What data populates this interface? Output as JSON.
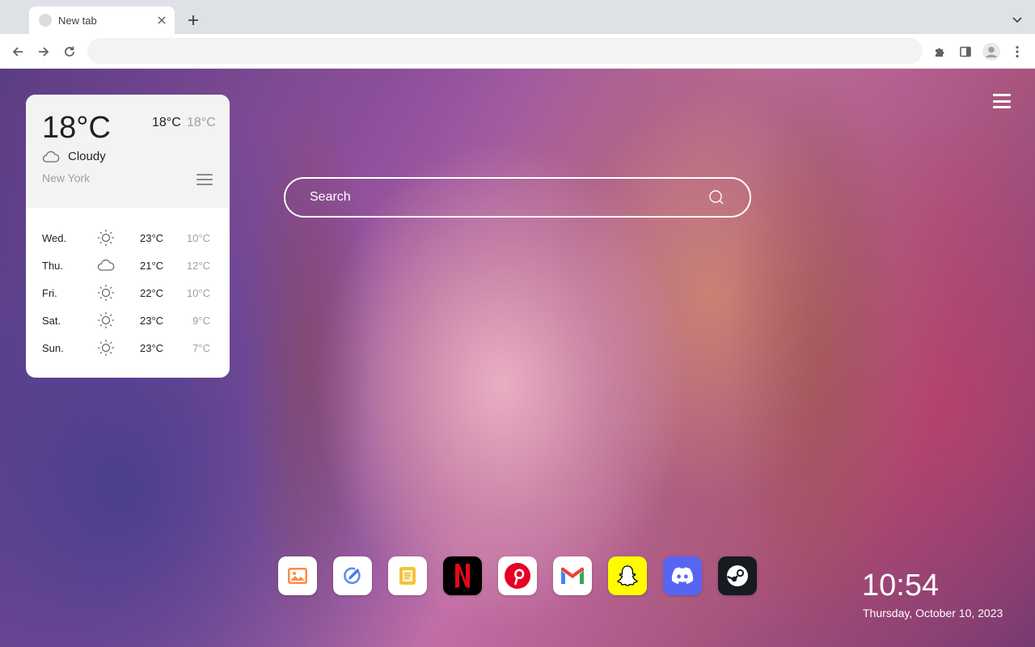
{
  "browser": {
    "tab_title": "New tab",
    "address_value": "",
    "icons": [
      "favicon",
      "close-icon",
      "plus-icon",
      "chevron-down-icon",
      "back-arrow-icon",
      "forward-arrow-icon",
      "reload-icon",
      "extensions-puzzle-icon",
      "side-panel-icon",
      "profile-avatar-icon",
      "kebab-menu-icon"
    ]
  },
  "weather": {
    "current_temp": "18°C",
    "high": "18°C",
    "low": "18°C",
    "condition": "Cloudy",
    "city": "New York",
    "forecast": [
      {
        "day": "Wed.",
        "icon": "sun-icon",
        "high": "23°C",
        "low": "10°C"
      },
      {
        "day": "Thu.",
        "icon": "cloud-icon",
        "high": "21°C",
        "low": "12°C"
      },
      {
        "day": "Fri.",
        "icon": "sun-icon",
        "high": "22°C",
        "low": "10°C"
      },
      {
        "day": "Sat.",
        "icon": "sun-icon",
        "high": "23°C",
        "low": "9°C"
      },
      {
        "day": "Sun.",
        "icon": "sun-icon",
        "high": "23°C",
        "low": "7°C"
      }
    ]
  },
  "search": {
    "placeholder": "Search"
  },
  "dock": [
    {
      "name": "photos",
      "icon": "photo-icon",
      "bg": "#ffffff"
    },
    {
      "name": "edit",
      "icon": "pen-circle-icon",
      "bg": "#ffffff"
    },
    {
      "name": "notes",
      "icon": "notes-icon",
      "bg": "#ffffff"
    },
    {
      "name": "netflix",
      "icon": "netflix-icon",
      "bg": "#000000"
    },
    {
      "name": "pinterest",
      "icon": "pinterest-icon",
      "bg": "#ffffff"
    },
    {
      "name": "gmail",
      "icon": "gmail-icon",
      "bg": "#ffffff"
    },
    {
      "name": "snapchat",
      "icon": "snapchat-icon",
      "bg": "#fffc00"
    },
    {
      "name": "discord",
      "icon": "discord-icon",
      "bg": "#5865f2"
    },
    {
      "name": "steam",
      "icon": "steam-icon",
      "bg": "#171a21"
    }
  ],
  "clock": {
    "time": "10:54",
    "date": "Thursday, October 10, 2023"
  }
}
